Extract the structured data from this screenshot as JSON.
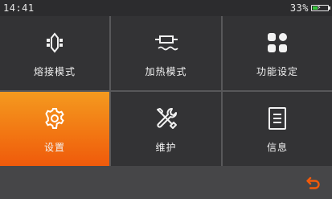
{
  "status": {
    "time": "14:41",
    "battery_percent_text": "33%",
    "battery_level": 0.33,
    "charging": true
  },
  "menu": {
    "tiles": [
      {
        "label": "熔接模式",
        "icon": "splice-mode-icon",
        "active": false
      },
      {
        "label": "加热模式",
        "icon": "heater-icon",
        "active": false
      },
      {
        "label": "功能设定",
        "icon": "function-grid-icon",
        "active": false
      },
      {
        "label": "设置",
        "icon": "gear-icon",
        "active": true
      },
      {
        "label": "维护",
        "icon": "wrench-screwdriver-icon",
        "active": false
      },
      {
        "label": "信息",
        "icon": "document-icon",
        "active": false
      }
    ]
  },
  "bottom": {
    "back_icon": "back-arrow-icon"
  },
  "colors": {
    "accent": "#f27713",
    "tile_bg": "#333335",
    "back_arrow": "#f25a0a",
    "battery_fill": "#36c43c"
  }
}
